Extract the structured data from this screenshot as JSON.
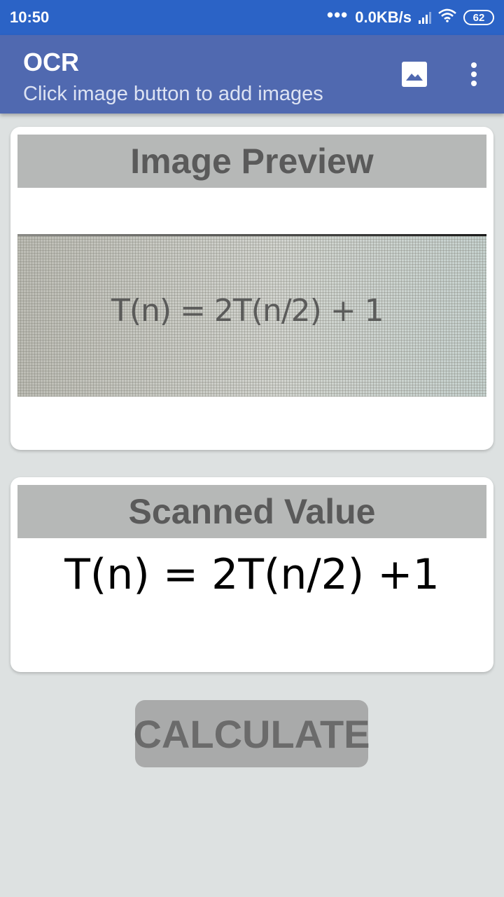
{
  "status_bar": {
    "time": "10:50",
    "network_speed": "0.0KB/s",
    "battery": "62",
    "icons": [
      "more-dots-icon",
      "signal-icon",
      "wifi-icon",
      "battery-icon"
    ]
  },
  "app_bar": {
    "title": "OCR",
    "subtitle": "Click image button to add images",
    "color": "#5069b0",
    "actions": [
      "image-icon",
      "overflow-menu-icon"
    ]
  },
  "preview_card": {
    "header": "Image Preview",
    "image_text": "T(n) = 2T(n/2) + 1"
  },
  "scanned_card": {
    "header": "Scanned Value",
    "value": "T(n) = 2T(n/2) +1"
  },
  "calculate_button": {
    "label": "CALCULATE"
  }
}
